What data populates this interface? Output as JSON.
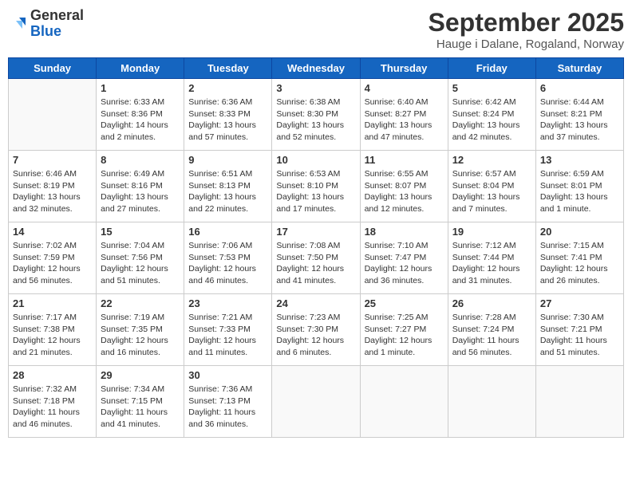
{
  "header": {
    "logo": {
      "line1": "General",
      "line2": "Blue"
    },
    "title": "September 2025",
    "subtitle": "Hauge i Dalane, Rogaland, Norway"
  },
  "days_of_week": [
    "Sunday",
    "Monday",
    "Tuesday",
    "Wednesday",
    "Thursday",
    "Friday",
    "Saturday"
  ],
  "weeks": [
    [
      {
        "num": "",
        "sunrise": "",
        "sunset": "",
        "daylight": "",
        "empty": true
      },
      {
        "num": "1",
        "sunrise": "Sunrise: 6:33 AM",
        "sunset": "Sunset: 8:36 PM",
        "daylight": "Daylight: 14 hours and 2 minutes."
      },
      {
        "num": "2",
        "sunrise": "Sunrise: 6:36 AM",
        "sunset": "Sunset: 8:33 PM",
        "daylight": "Daylight: 13 hours and 57 minutes."
      },
      {
        "num": "3",
        "sunrise": "Sunrise: 6:38 AM",
        "sunset": "Sunset: 8:30 PM",
        "daylight": "Daylight: 13 hours and 52 minutes."
      },
      {
        "num": "4",
        "sunrise": "Sunrise: 6:40 AM",
        "sunset": "Sunset: 8:27 PM",
        "daylight": "Daylight: 13 hours and 47 minutes."
      },
      {
        "num": "5",
        "sunrise": "Sunrise: 6:42 AM",
        "sunset": "Sunset: 8:24 PM",
        "daylight": "Daylight: 13 hours and 42 minutes."
      },
      {
        "num": "6",
        "sunrise": "Sunrise: 6:44 AM",
        "sunset": "Sunset: 8:21 PM",
        "daylight": "Daylight: 13 hours and 37 minutes."
      }
    ],
    [
      {
        "num": "7",
        "sunrise": "Sunrise: 6:46 AM",
        "sunset": "Sunset: 8:19 PM",
        "daylight": "Daylight: 13 hours and 32 minutes."
      },
      {
        "num": "8",
        "sunrise": "Sunrise: 6:49 AM",
        "sunset": "Sunset: 8:16 PM",
        "daylight": "Daylight: 13 hours and 27 minutes."
      },
      {
        "num": "9",
        "sunrise": "Sunrise: 6:51 AM",
        "sunset": "Sunset: 8:13 PM",
        "daylight": "Daylight: 13 hours and 22 minutes."
      },
      {
        "num": "10",
        "sunrise": "Sunrise: 6:53 AM",
        "sunset": "Sunset: 8:10 PM",
        "daylight": "Daylight: 13 hours and 17 minutes."
      },
      {
        "num": "11",
        "sunrise": "Sunrise: 6:55 AM",
        "sunset": "Sunset: 8:07 PM",
        "daylight": "Daylight: 13 hours and 12 minutes."
      },
      {
        "num": "12",
        "sunrise": "Sunrise: 6:57 AM",
        "sunset": "Sunset: 8:04 PM",
        "daylight": "Daylight: 13 hours and 7 minutes."
      },
      {
        "num": "13",
        "sunrise": "Sunrise: 6:59 AM",
        "sunset": "Sunset: 8:01 PM",
        "daylight": "Daylight: 13 hours and 1 minute."
      }
    ],
    [
      {
        "num": "14",
        "sunrise": "Sunrise: 7:02 AM",
        "sunset": "Sunset: 7:59 PM",
        "daylight": "Daylight: 12 hours and 56 minutes."
      },
      {
        "num": "15",
        "sunrise": "Sunrise: 7:04 AM",
        "sunset": "Sunset: 7:56 PM",
        "daylight": "Daylight: 12 hours and 51 minutes."
      },
      {
        "num": "16",
        "sunrise": "Sunrise: 7:06 AM",
        "sunset": "Sunset: 7:53 PM",
        "daylight": "Daylight: 12 hours and 46 minutes."
      },
      {
        "num": "17",
        "sunrise": "Sunrise: 7:08 AM",
        "sunset": "Sunset: 7:50 PM",
        "daylight": "Daylight: 12 hours and 41 minutes."
      },
      {
        "num": "18",
        "sunrise": "Sunrise: 7:10 AM",
        "sunset": "Sunset: 7:47 PM",
        "daylight": "Daylight: 12 hours and 36 minutes."
      },
      {
        "num": "19",
        "sunrise": "Sunrise: 7:12 AM",
        "sunset": "Sunset: 7:44 PM",
        "daylight": "Daylight: 12 hours and 31 minutes."
      },
      {
        "num": "20",
        "sunrise": "Sunrise: 7:15 AM",
        "sunset": "Sunset: 7:41 PM",
        "daylight": "Daylight: 12 hours and 26 minutes."
      }
    ],
    [
      {
        "num": "21",
        "sunrise": "Sunrise: 7:17 AM",
        "sunset": "Sunset: 7:38 PM",
        "daylight": "Daylight: 12 hours and 21 minutes."
      },
      {
        "num": "22",
        "sunrise": "Sunrise: 7:19 AM",
        "sunset": "Sunset: 7:35 PM",
        "daylight": "Daylight: 12 hours and 16 minutes."
      },
      {
        "num": "23",
        "sunrise": "Sunrise: 7:21 AM",
        "sunset": "Sunset: 7:33 PM",
        "daylight": "Daylight: 12 hours and 11 minutes."
      },
      {
        "num": "24",
        "sunrise": "Sunrise: 7:23 AM",
        "sunset": "Sunset: 7:30 PM",
        "daylight": "Daylight: 12 hours and 6 minutes."
      },
      {
        "num": "25",
        "sunrise": "Sunrise: 7:25 AM",
        "sunset": "Sunset: 7:27 PM",
        "daylight": "Daylight: 12 hours and 1 minute."
      },
      {
        "num": "26",
        "sunrise": "Sunrise: 7:28 AM",
        "sunset": "Sunset: 7:24 PM",
        "daylight": "Daylight: 11 hours and 56 minutes."
      },
      {
        "num": "27",
        "sunrise": "Sunrise: 7:30 AM",
        "sunset": "Sunset: 7:21 PM",
        "daylight": "Daylight: 11 hours and 51 minutes."
      }
    ],
    [
      {
        "num": "28",
        "sunrise": "Sunrise: 7:32 AM",
        "sunset": "Sunset: 7:18 PM",
        "daylight": "Daylight: 11 hours and 46 minutes."
      },
      {
        "num": "29",
        "sunrise": "Sunrise: 7:34 AM",
        "sunset": "Sunset: 7:15 PM",
        "daylight": "Daylight: 11 hours and 41 minutes."
      },
      {
        "num": "30",
        "sunrise": "Sunrise: 7:36 AM",
        "sunset": "Sunset: 7:13 PM",
        "daylight": "Daylight: 11 hours and 36 minutes."
      },
      {
        "num": "",
        "sunrise": "",
        "sunset": "",
        "daylight": "",
        "empty": true
      },
      {
        "num": "",
        "sunrise": "",
        "sunset": "",
        "daylight": "",
        "empty": true
      },
      {
        "num": "",
        "sunrise": "",
        "sunset": "",
        "daylight": "",
        "empty": true
      },
      {
        "num": "",
        "sunrise": "",
        "sunset": "",
        "daylight": "",
        "empty": true
      }
    ]
  ]
}
